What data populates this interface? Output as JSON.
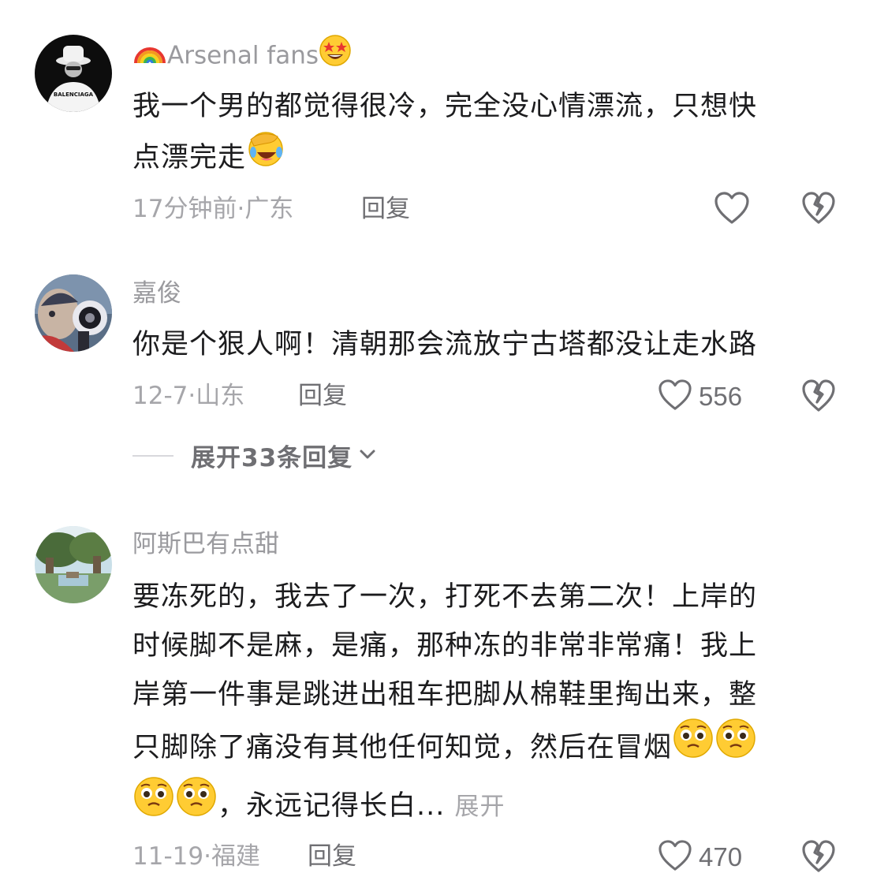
{
  "comments": [
    {
      "username_emoji_prefix": "rainbow-emoji",
      "username": "Arsenal fans",
      "username_emoji_suffix": "star-struck-emoji",
      "avatar": "balenciaga-avatar",
      "text_line1": "我一个男的都觉得很冷，完全没心情漂流，只想快",
      "text_line2": "点漂完走",
      "text_emoji": "face-palm-laughing-emoji",
      "time": "17分钟前",
      "location": "广东",
      "reply_label": "回复",
      "like_count": ""
    },
    {
      "username": "嘉俊",
      "avatar": "megaphone-avatar",
      "text_line1": "你是个狠人啊！清朝那会流放宁古塔都没让走水路",
      "time": "12-7",
      "location": "山东",
      "reply_label": "回复",
      "like_count": "556",
      "expand_replies_label": "展开33条回复"
    },
    {
      "username": "阿斯巴有点甜",
      "avatar": "landscape-avatar",
      "text_line1": "要冻死的，我去了一次，打死不去第二次！上岸的",
      "text_line2": "时候脚不是麻，是痛，那种冻的非常非常痛！我上",
      "text_line3": "岸第一件事是跳进出租车把脚从棉鞋里掏出来，整",
      "text_line4": "只脚除了痛没有其他任何知觉，然后在冒烟",
      "text_line5": "，永远记得长白...",
      "more_label": "展开",
      "text_emoji": "pleading-face-emoji",
      "time": "11-19",
      "location": "福建",
      "reply_label": "回复",
      "like_count": "470"
    }
  ],
  "separator": "·",
  "colors": {
    "username": "#9a9a9e",
    "text": "#1c1c1e",
    "meta": "#a6a6aa",
    "action": "#6f6f73"
  }
}
